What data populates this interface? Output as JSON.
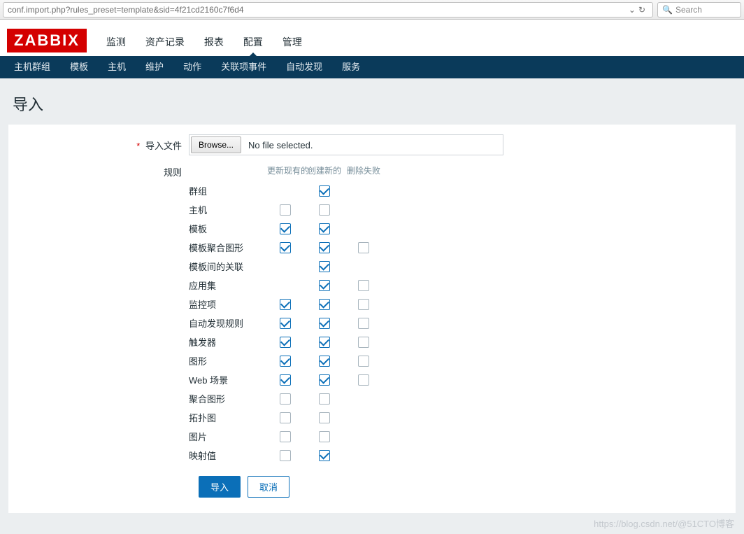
{
  "browser": {
    "url": "conf.import.php?rules_preset=template&sid=4f21cd2160c7f6d4",
    "dropdown_glyph": "⌄",
    "reload_glyph": "↻",
    "search_placeholder": "Search",
    "search_glyph": "🔍"
  },
  "logo": "ZABBIX",
  "topnav": [
    {
      "label": "监测",
      "active": false
    },
    {
      "label": "资产记录",
      "active": false
    },
    {
      "label": "报表",
      "active": false
    },
    {
      "label": "配置",
      "active": true
    },
    {
      "label": "管理",
      "active": false
    }
  ],
  "subnav": [
    "主机群组",
    "模板",
    "主机",
    "维护",
    "动作",
    "关联项事件",
    "自动发现",
    "服务"
  ],
  "page_title": "导入",
  "form": {
    "file_label": "导入文件",
    "browse_label": "Browse...",
    "file_status": "No file selected.",
    "rules_label": "规则",
    "headers": {
      "update": "更新现有的",
      "create": "创建新的",
      "delete": "删除失败"
    }
  },
  "rules": [
    {
      "label": "群组",
      "update": null,
      "create": true,
      "delete": null
    },
    {
      "label": "主机",
      "update": false,
      "create": false,
      "delete": null
    },
    {
      "label": "模板",
      "update": true,
      "create": true,
      "delete": null
    },
    {
      "label": "模板聚合图形",
      "update": true,
      "create": true,
      "delete": false
    },
    {
      "label": "模板间的关联",
      "update": null,
      "create": true,
      "delete": null
    },
    {
      "label": "应用集",
      "update": null,
      "create": true,
      "delete": false
    },
    {
      "label": "监控项",
      "update": true,
      "create": true,
      "delete": false
    },
    {
      "label": "自动发现规则",
      "update": true,
      "create": true,
      "delete": false
    },
    {
      "label": "触发器",
      "update": true,
      "create": true,
      "delete": false
    },
    {
      "label": "图形",
      "update": true,
      "create": true,
      "delete": false
    },
    {
      "label": "Web 场景",
      "update": true,
      "create": true,
      "delete": false
    },
    {
      "label": "聚合图形",
      "update": false,
      "create": false,
      "delete": null
    },
    {
      "label": "拓扑图",
      "update": false,
      "create": false,
      "delete": null
    },
    {
      "label": "图片",
      "update": false,
      "create": false,
      "delete": null
    },
    {
      "label": "映射值",
      "update": false,
      "create": true,
      "delete": null
    }
  ],
  "buttons": {
    "submit": "导入",
    "cancel": "取消"
  },
  "watermark": "https://blog.csdn.net/@51CTO博客"
}
